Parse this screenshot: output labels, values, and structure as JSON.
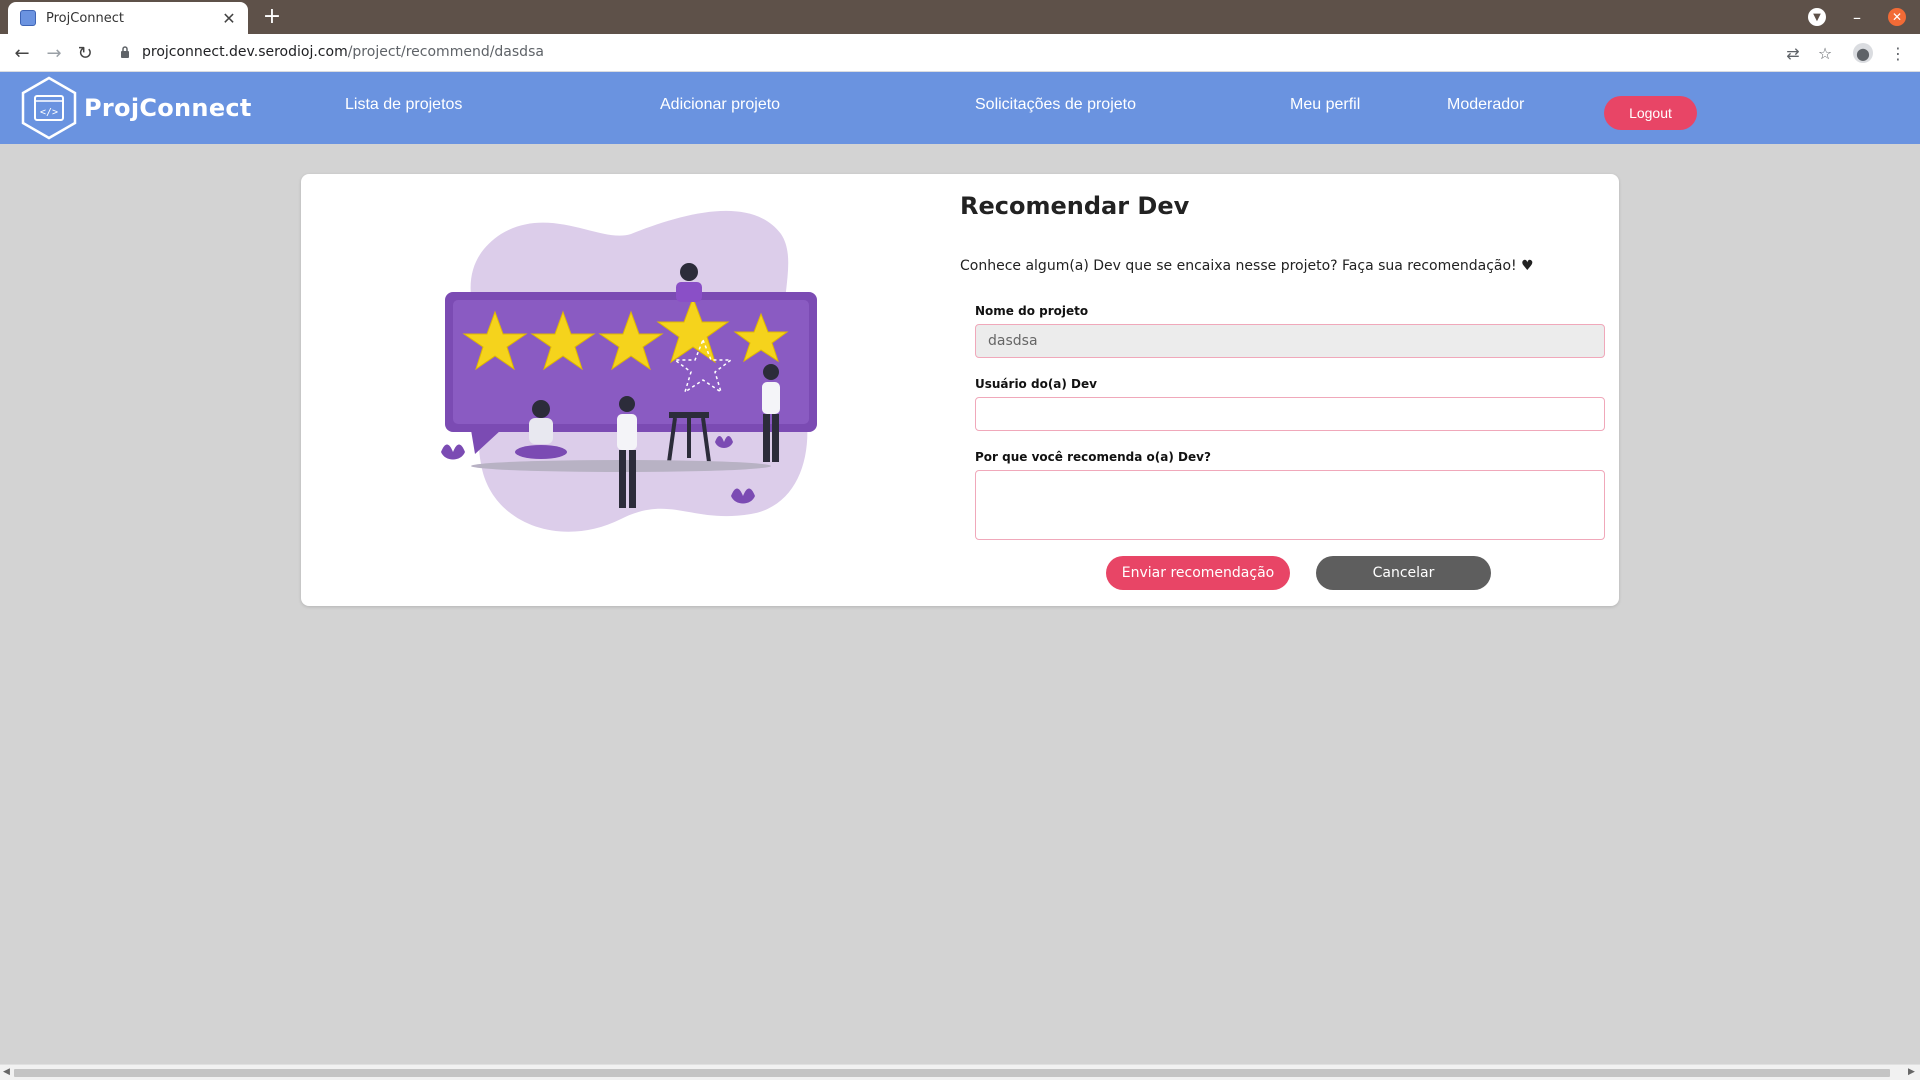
{
  "browser": {
    "tab_title": "ProjConnect",
    "url_domain": "projconnect.dev.serodioj.com",
    "url_path": "/project/recommend/dasdsa"
  },
  "header": {
    "logo_text": "ProjConnect",
    "nav": [
      {
        "label": "Lista de projetos"
      },
      {
        "label": "Adicionar projeto"
      },
      {
        "label": "Solicitações de projeto"
      },
      {
        "label": "Meu perfil"
      },
      {
        "label": "Moderador"
      }
    ],
    "logout_label": "Logout"
  },
  "form": {
    "title": "Recomendar Dev",
    "intro": "Conhece algum(a) Dev que se encaixa nesse projeto? Faça sua recomendação! ♥",
    "project_name_label": "Nome do projeto",
    "project_name_value": "dasdsa",
    "dev_user_label": "Usuário do(a) Dev",
    "dev_user_value": "",
    "reason_label": "Por que você recomenda o(a) Dev?",
    "reason_value": "",
    "submit_label": "Enviar recomendação",
    "cancel_label": "Cancelar"
  },
  "colors": {
    "header_bg": "#6a93e0",
    "accent_pink": "#e84566",
    "cancel_gray": "#5e5e5e",
    "page_bg": "#d3d3d3",
    "illustration_purple": "#7b4bb3",
    "illustration_blob": "#dccdea",
    "star_yellow": "#f5d31c"
  }
}
